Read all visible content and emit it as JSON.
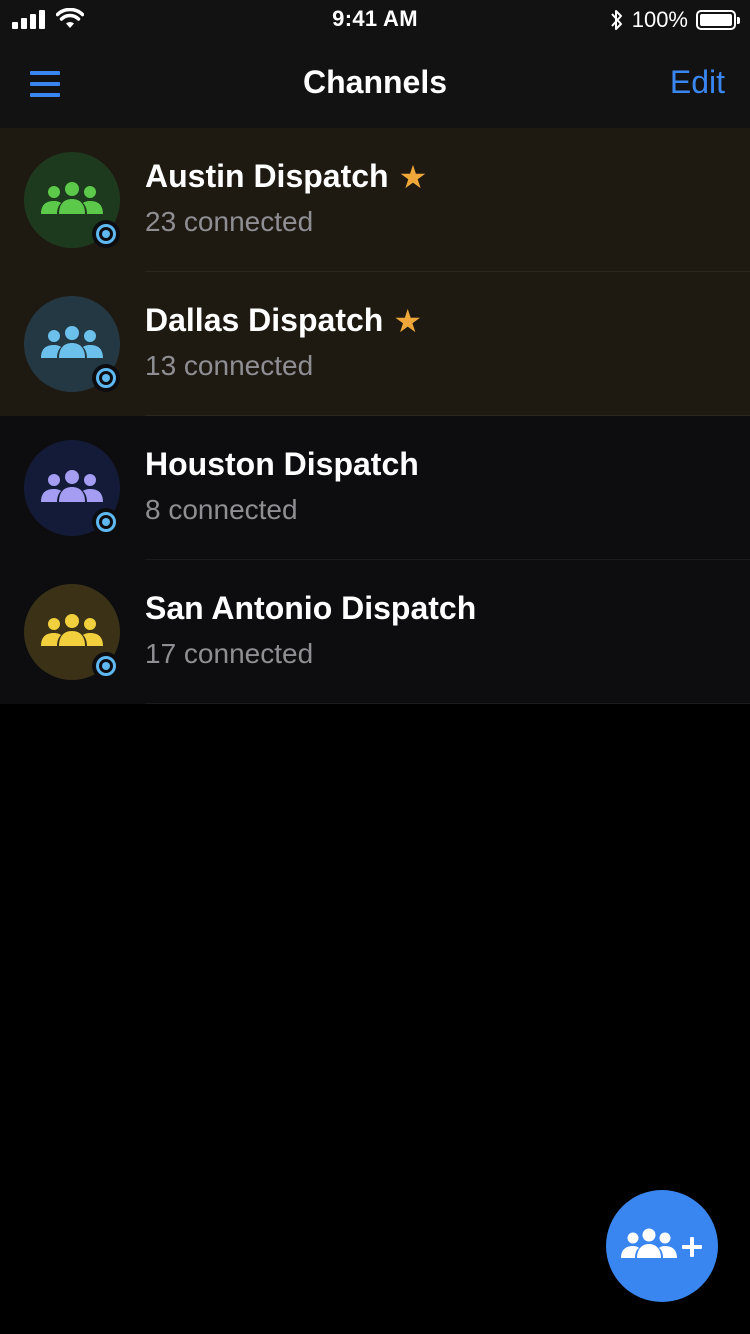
{
  "status_bar": {
    "time": "9:41 AM",
    "battery_text": "100%",
    "battery_level": 1.0,
    "icons": [
      "signal-icon",
      "wifi-icon",
      "bluetooth-icon",
      "battery-icon"
    ]
  },
  "nav": {
    "title": "Channels",
    "edit_label": "Edit",
    "menu_icon": "hamburger-menu-icon"
  },
  "colors": {
    "accent": "#3a86f0",
    "favorite_star": "#f0a73a",
    "live_badge": "#5fb8f0",
    "favorite_row_bg": "#1e1a12",
    "normal_row_bg": "#0d0d10",
    "secondary_text": "#8e8e93"
  },
  "channels": [
    {
      "name": "Austin Dispatch",
      "count": "23 connected",
      "favorite": true,
      "avatar_bg": "#1e3a1e",
      "icon_color": "#5cc94a",
      "icon": "group-icon"
    },
    {
      "name": "Dallas Dispatch",
      "count": "13 connected",
      "favorite": true,
      "avatar_bg": "#243844",
      "icon_color": "#6cc0ec",
      "icon": "group-icon"
    },
    {
      "name": "Houston Dispatch",
      "count": "8 connected",
      "favorite": false,
      "avatar_bg": "#141b38",
      "icon_color": "#a49df2",
      "icon": "group-icon"
    },
    {
      "name": "San Antonio Dispatch",
      "count": "17 connected",
      "favorite": false,
      "avatar_bg": "#3a3116",
      "icon_color": "#f2cf3c",
      "icon": "group-icon"
    }
  ],
  "fab": {
    "icon": "add-group-icon"
  }
}
